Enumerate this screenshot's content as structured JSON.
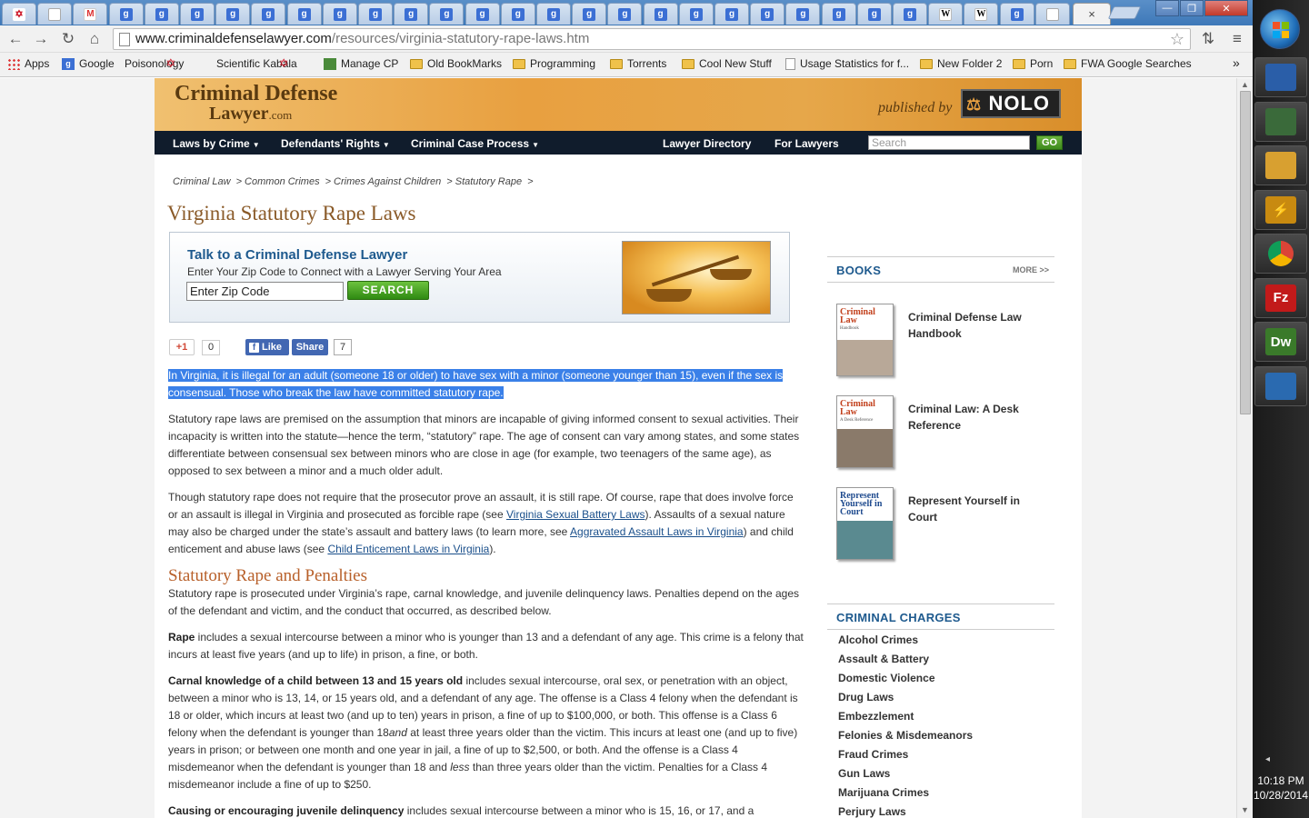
{
  "browser": {
    "url_domain": "www.criminaldefenselawyer.com",
    "url_path": "/resources/virginia-statutory-rape-laws.htm",
    "tab_close": "×",
    "tab_icons": [
      "s",
      "p",
      "m",
      "g",
      "g",
      "g",
      "g",
      "g",
      "g",
      "g",
      "g",
      "g",
      "g",
      "g",
      "g",
      "g",
      "g",
      "g",
      "g",
      "g",
      "g",
      "g",
      "g",
      "g",
      "g",
      "g",
      "w",
      "w",
      "g",
      "p"
    ],
    "window_buttons": {
      "minimize": "—",
      "maximize": "❐",
      "close": "✕"
    }
  },
  "bookmarks": [
    {
      "label": "Apps",
      "icon": "apps-icon"
    },
    {
      "label": "Google",
      "icon": "google-icon"
    },
    {
      "label": "Poisonology",
      "icon": "star-icon"
    },
    {
      "label": "Scientific Kabala",
      "icon": "star-icon"
    },
    {
      "label": "Manage CP",
      "icon": "cp-icon"
    },
    {
      "label": "Old BookMarks",
      "icon": "folder-icon"
    },
    {
      "label": "Programming",
      "icon": "folder-icon"
    },
    {
      "label": "Torrents",
      "icon": "folder-icon"
    },
    {
      "label": "Cool New Stuff",
      "icon": "folder-icon"
    },
    {
      "label": "Usage Statistics for f...",
      "icon": "page-icon"
    },
    {
      "label": "New Folder 2",
      "icon": "folder-icon"
    },
    {
      "label": "Porn",
      "icon": "folder-icon"
    },
    {
      "label": "FWA Google Searches",
      "icon": "folder-icon"
    }
  ],
  "bookmarks_more": "»",
  "site": {
    "logo_line1": "Criminal Defense",
    "logo_line2": "Lawyer",
    "logo_tld": ".com",
    "published_by": "published by",
    "nolo": "NOLO",
    "nav": {
      "laws_by_crime": "Laws by Crime",
      "defendants_rights": "Defendants' Rights",
      "criminal_case_process": "Criminal Case Process",
      "lawyer_directory": "Lawyer Directory",
      "for_lawyers": "For Lawyers",
      "search_placeholder": "Search",
      "go": "GO"
    },
    "breadcrumb": [
      "Criminal Law",
      "> Common Crimes",
      "> Crimes Against Children",
      "> Statutory Rape",
      ">"
    ],
    "title": "Virginia Statutory Rape Laws",
    "cta": {
      "heading": "Talk to a Criminal Defense Lawyer",
      "sub": "Enter Your Zip Code to Connect with a Lawyer Serving Your Area",
      "zip_value": "Enter Zip Code",
      "button": "SEARCH"
    },
    "social": {
      "gplus": "+1",
      "gplus_count": "0",
      "like": "Like",
      "share": "Share",
      "share_count": "7"
    }
  },
  "article": {
    "p1": "In Virginia, it is illegal for an adult (someone 18 or older) to have sex with a minor (someone younger than 15), even if the sex is consensual. Those who break the law have committed statutory rape.",
    "p2": "Statutory rape laws are premised on the assumption that minors are incapable of giving informed consent to sexual activities. Their incapacity is written into the statute—hence the term, “statutory” rape. The age of consent can vary among states, and some states differentiate between consensual sex between minors who are close in age (for example, two teenagers of the same age), as opposed to sex between a minor and a much older adult.",
    "p3a": "Though statutory rape does not require that the prosecutor prove an assault, it is still rape. Of course, rape that does involve force or an assault is illegal in Virginia and prosecuted as forcible rape (see ",
    "p3_link1": "Virginia Sexual Battery Laws",
    "p3b": "). Assaults of a sexual nature may also be charged under the state’s assault and battery laws (to learn more, see ",
    "p3_link2": "Aggravated Assault Laws in Virginia",
    "p3c": ") and child enticement and abuse laws (see ",
    "p3_link3": "Child Enticement Laws in Virginia",
    "p3d": ").",
    "h2": "Statutory Rape and Penalties",
    "p4": "Statutory rape is prosecuted under Virginia’s rape, carnal knowledge, and juvenile delinquency laws. Penalties depend on the ages of the defendant and victim, and the conduct that occurred, as described below.",
    "p5_bold": "Rape",
    "p5": " includes a sexual intercourse between a minor who is younger than 13 and a defendant of any age. This crime is a felony that incurs at least five years (and up to life) in prison, a fine, or both.",
    "p6_bold": "Carnal knowledge of a child between 13 and 15 years old",
    "p6a": " includes sexual intercourse, oral sex, or penetration with an object, between a minor who is 13, 14, or 15 years old, and a defendant of any age. The offense is a Class 4 felony when the defendant is 18 or older, which incurs at least two (and up to ten) years in prison, a fine of up to $100,000, or both. This offense is a Class 6 felony when the defendant is younger than 18",
    "p6_and": "and",
    "p6b": " at least three years older than the victim. This incurs at least one (and up to five) years in prison; or between one month and one year in jail, a fine of up to $2,500, or both. And the offense is a Class 4 misdemeanor when the defendant is younger than 18 and ",
    "p6_less": "less",
    "p6c": " than three years older than the victim. Penalties for a Class 4 misdemeanor include a fine of up to $250.",
    "p7_bold": "Causing or encouraging juvenile delinquency",
    "p7": " includes sexual intercourse between a minor who is 15, 16, or 17, and a"
  },
  "sidebar": {
    "books_title": "BOOKS",
    "books_more": "MORE >>",
    "books": [
      {
        "name": "Criminal Defense Law Handbook",
        "cover_title": "Criminal Law",
        "cover_sub": "Handbook"
      },
      {
        "name": "Criminal Law: A Desk Reference",
        "cover_title": "Criminal Law",
        "cover_sub": "A Desk Reference"
      },
      {
        "name": "Represent Yourself in Court",
        "cover_title": "Represent Yourself in Court",
        "cover_sub": ""
      }
    ],
    "charges_title": "CRIMINAL CHARGES",
    "charges": [
      "Alcohol Crimes",
      "Assault & Battery",
      "Domestic Violence",
      "Drug Laws",
      "Embezzlement",
      "Felonies & Misdemeanors",
      "Fraud Crimes",
      "Gun Laws",
      "Marijuana Crimes",
      "Perjury Laws"
    ]
  },
  "taskbar": {
    "apps": [
      {
        "name": "network-icon",
        "label": "",
        "color": "#2a5ea8"
      },
      {
        "name": "computer-icon",
        "label": "",
        "color": "#3a6a3a"
      },
      {
        "name": "file-explorer-icon",
        "label": "",
        "color": "#d8a030"
      },
      {
        "name": "winamp-icon",
        "label": "⚡",
        "color": "#c88a10"
      },
      {
        "name": "chrome-icon",
        "label": "",
        "color": "#3a8a3a"
      },
      {
        "name": "filezilla-icon",
        "label": "Fz",
        "color": "#c21a1a"
      },
      {
        "name": "dreamweaver-icon",
        "label": "Dw",
        "color": "#3a7a2a"
      },
      {
        "name": "paint-icon",
        "label": "",
        "color": "#2a6ab0"
      }
    ],
    "time": "10:18 PM",
    "date": "10/28/2014",
    "tray_arrow": "◂"
  }
}
